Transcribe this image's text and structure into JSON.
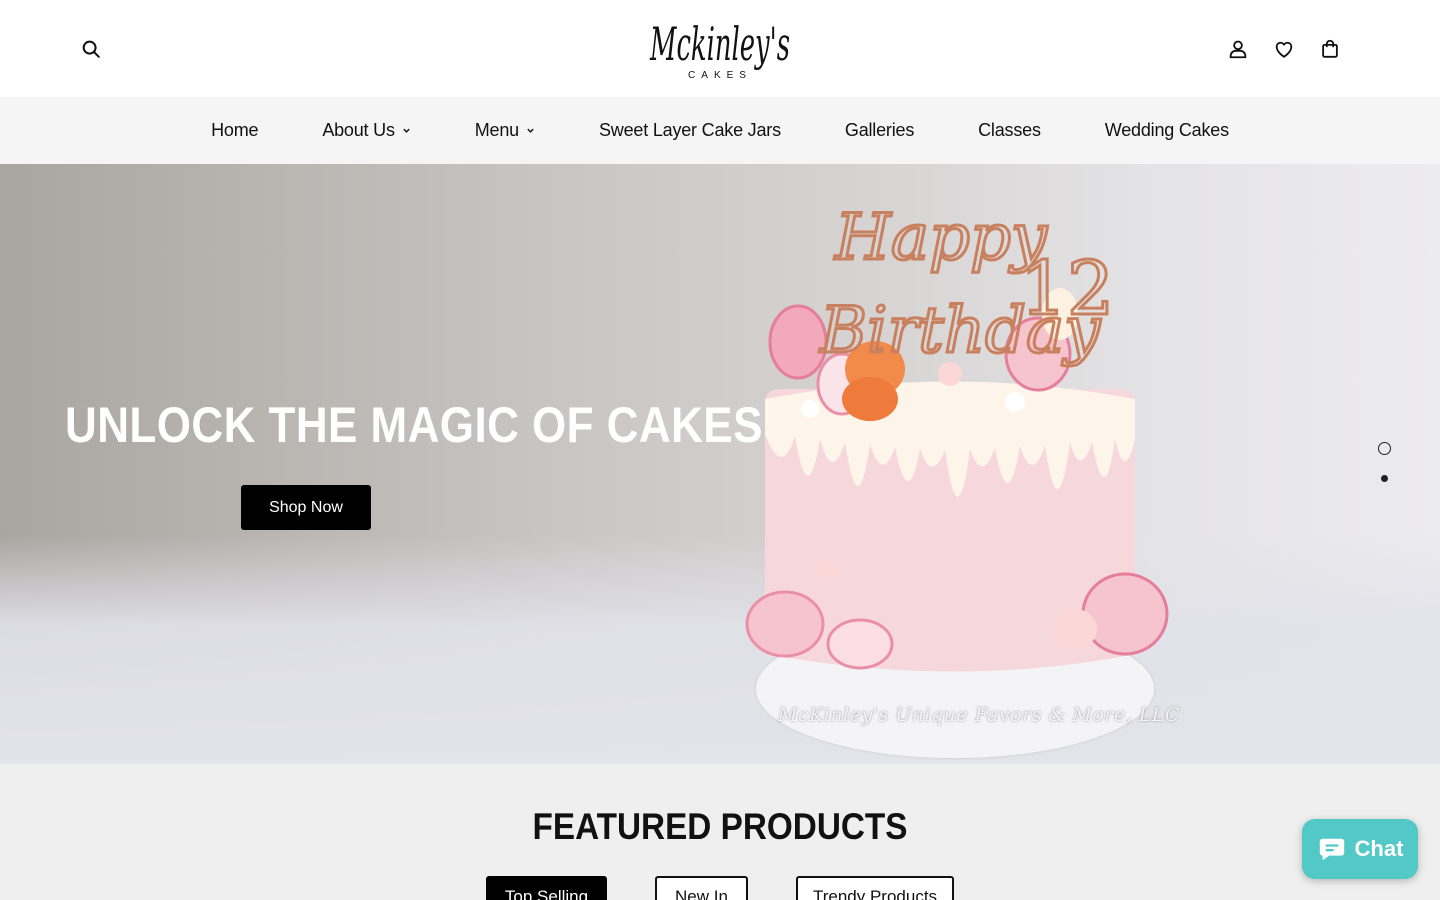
{
  "header": {
    "logo_main": "Mckinley's",
    "logo_sub": "CAKES",
    "search_icon": "search-icon",
    "account_icon": "user-icon",
    "wishlist_icon": "heart-icon",
    "cart_icon": "shopping-bag-icon"
  },
  "nav": {
    "items": [
      {
        "label": "Home",
        "has_dropdown": false
      },
      {
        "label": "About Us",
        "has_dropdown": true
      },
      {
        "label": "Menu",
        "has_dropdown": true
      },
      {
        "label": "Sweet Layer Cake Jars",
        "has_dropdown": false
      },
      {
        "label": "Galleries",
        "has_dropdown": false
      },
      {
        "label": "Classes",
        "has_dropdown": false
      },
      {
        "label": "Wedding Cakes",
        "has_dropdown": false
      }
    ]
  },
  "hero": {
    "title": "UNLOCK THE MAGIC OF CAKES",
    "cta": "Shop Now",
    "topper_line1": "Happy",
    "topper_line2": "Birthday",
    "topper_number": "12",
    "watermark": "McKinley's Unique Favors & More, LLC",
    "slides": 2,
    "active_slide": 1
  },
  "featured": {
    "title": "FEATURED PRODUCTS",
    "tabs": [
      {
        "label": "Top Selling",
        "active": true
      },
      {
        "label": "New In",
        "active": false
      },
      {
        "label": "Trendy Products",
        "active": false
      }
    ]
  },
  "chat": {
    "label": "Chat",
    "color": "#53c9c7"
  }
}
